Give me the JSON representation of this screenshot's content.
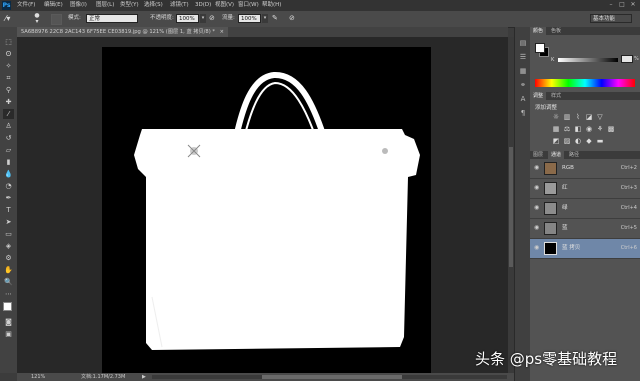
{
  "app": {
    "logo": "Ps"
  },
  "menu": [
    "文件(F)",
    "编辑(E)",
    "图像(I)",
    "图层(L)",
    "类型(Y)",
    "选择(S)",
    "滤镜(T)",
    "3D(D)",
    "视图(V)",
    "窗口(W)",
    "帮助(H)"
  ],
  "window_controls": [
    "–",
    "□",
    "✕"
  ],
  "options": {
    "mode_label": "模式:",
    "mode_value": "正常",
    "opacity_label": "不透明度:",
    "opacity_value": "100%",
    "flow_label": "流量:",
    "flow_value": "100%",
    "workspace": "基本功能"
  },
  "document": {
    "tab_title": "5A6B8976 22C8 2AC143 6F75EE CE03819.jpg @ 121% (图层 1, 蓝 拷贝/8) *",
    "close": "×"
  },
  "status": {
    "zoom": "121%",
    "doc_info": "文档:1.17M/2.73M",
    "arrow": "▶"
  },
  "panels": {
    "color": {
      "tabs": [
        "颜色",
        "色板"
      ],
      "k_label": "K",
      "k_percent": "%"
    },
    "adjustments": {
      "tabs": [
        "调整",
        "样式"
      ],
      "title": "添加调整"
    },
    "channels": {
      "tabs": [
        "图层",
        "通道",
        "路径"
      ],
      "rows": [
        {
          "name": "RGB",
          "key": "Ctrl+2",
          "visible": true,
          "selected": false,
          "thumb_color": "#8a6a4a"
        },
        {
          "name": "红",
          "key": "Ctrl+3",
          "visible": true,
          "selected": false,
          "thumb_color": "#9a9a9a"
        },
        {
          "name": "绿",
          "key": "Ctrl+4",
          "visible": true,
          "selected": false,
          "thumb_color": "#8c8c8c"
        },
        {
          "name": "蓝",
          "key": "Ctrl+5",
          "visible": true,
          "selected": false,
          "thumb_color": "#858585"
        },
        {
          "name": "蓝 拷贝",
          "key": "Ctrl+6",
          "visible": true,
          "selected": true,
          "thumb_color": "#000000"
        }
      ]
    }
  },
  "watermark": "头条 @ps零基础教程",
  "colors": {
    "foreground": "#ffffff",
    "background": "#000000",
    "selection": "#6f87a8"
  }
}
